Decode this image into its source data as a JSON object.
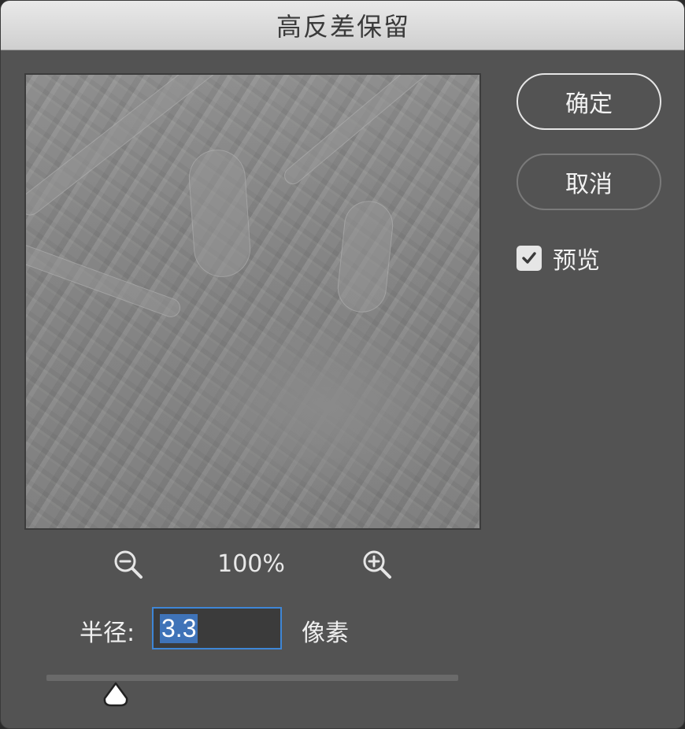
{
  "window": {
    "title": "高反差保留"
  },
  "buttons": {
    "ok_label": "确定",
    "cancel_label": "取消"
  },
  "preview_toggle": {
    "label": "预览",
    "checked": true
  },
  "zoom": {
    "level": "100%",
    "zoom_out_icon": "zoom-out-icon",
    "zoom_in_icon": "zoom-in-icon"
  },
  "radius": {
    "label": "半径:",
    "value": "3.3",
    "unit": "像素"
  },
  "slider": {
    "value": 3.3
  },
  "colors": {
    "dialog_bg": "#535353",
    "accent": "#3e86d6",
    "selection": "#3f73b8"
  }
}
